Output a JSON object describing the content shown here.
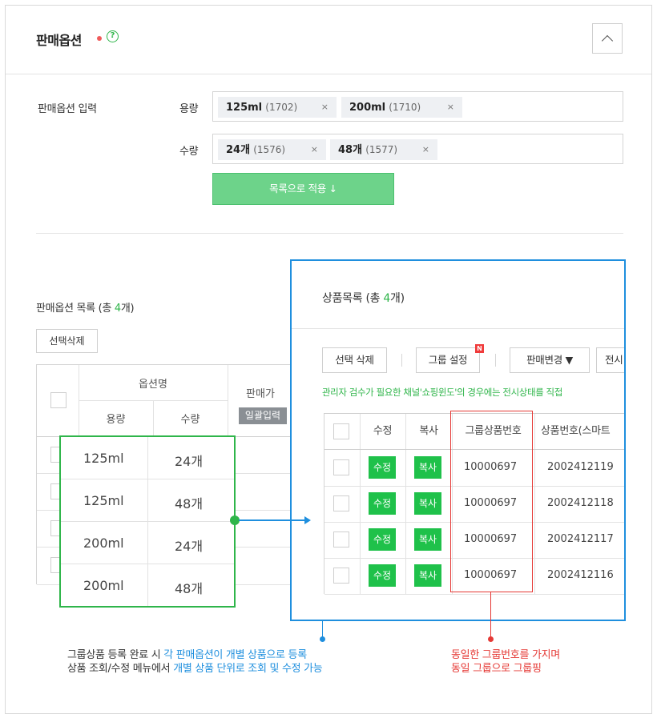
{
  "header": {
    "title": "판매옵션",
    "help_icon": "?"
  },
  "option_input": {
    "label": "판매옵션 입력",
    "rows": [
      {
        "name": "용량",
        "tags": [
          {
            "value": "125ml",
            "count": "(1702)"
          },
          {
            "value": "200ml",
            "count": "(1710)"
          }
        ]
      },
      {
        "name": "수량",
        "tags": [
          {
            "value": "24개",
            "count": "(1576)"
          },
          {
            "value": "48개",
            "count": "(1577)"
          }
        ]
      }
    ],
    "remove_glyph": "×",
    "apply_button": "목록으로 적용 ↓"
  },
  "option_list": {
    "title_prefix": "판매옵션 목록 (총 ",
    "count": "4",
    "title_suffix": "개)",
    "delete_button": "선택삭제",
    "headers": {
      "option_name": "옵션명",
      "price": "판매가",
      "capacity": "용량",
      "quantity": "수량",
      "bulk": "일괄입력"
    },
    "rows": [
      {
        "capacity": "125ml",
        "quantity": "24개"
      },
      {
        "capacity": "125ml",
        "quantity": "48개"
      },
      {
        "capacity": "200ml",
        "quantity": "24개"
      },
      {
        "capacity": "200ml",
        "quantity": "48개"
      }
    ]
  },
  "product_panel": {
    "title_prefix": "상품목록 (총 ",
    "count": "4",
    "title_suffix": "개)",
    "buttons": {
      "delete": "선택 삭제",
      "group": "그룹 설정",
      "sale_change": "판매변경 ▼",
      "display": "전시"
    },
    "new_badge": "N",
    "notice": "관리자 검수가 필요한 채널'쇼핑윈도'의 경우에는 전시상태를 직접",
    "headers": {
      "edit": "수정",
      "copy": "복사",
      "group_no": "그룹상품번호",
      "product_no": "상품번호(스마트"
    },
    "edit_label": "수정",
    "copy_label": "복사",
    "rows": [
      {
        "group_no": "10000697",
        "product_no": "2002412119"
      },
      {
        "group_no": "10000697",
        "product_no": "2002412118"
      },
      {
        "group_no": "10000697",
        "product_no": "2002412117"
      },
      {
        "group_no": "10000697",
        "product_no": "2002412116"
      }
    ]
  },
  "captions": {
    "left_line1_a": "그룹상품 등록 완료 시 ",
    "left_line1_b": "각 판매옵션이 개별 상품으로 등록",
    "left_line2_a": "상품 조회/수정 메뉴에서 ",
    "left_line2_b": "개별 상품 단위로 조회 및 수정 가능",
    "right_line1": "동일한 그룹번호를 가지며",
    "right_line2": "동일 그룹으로 그룹핑"
  },
  "colors": {
    "accent_green": "#2fb54a",
    "button_green": "#1fc14a",
    "apply_green": "#6dd38a",
    "highlight_blue": "#1f8fde",
    "highlight_red": "#e53935"
  }
}
